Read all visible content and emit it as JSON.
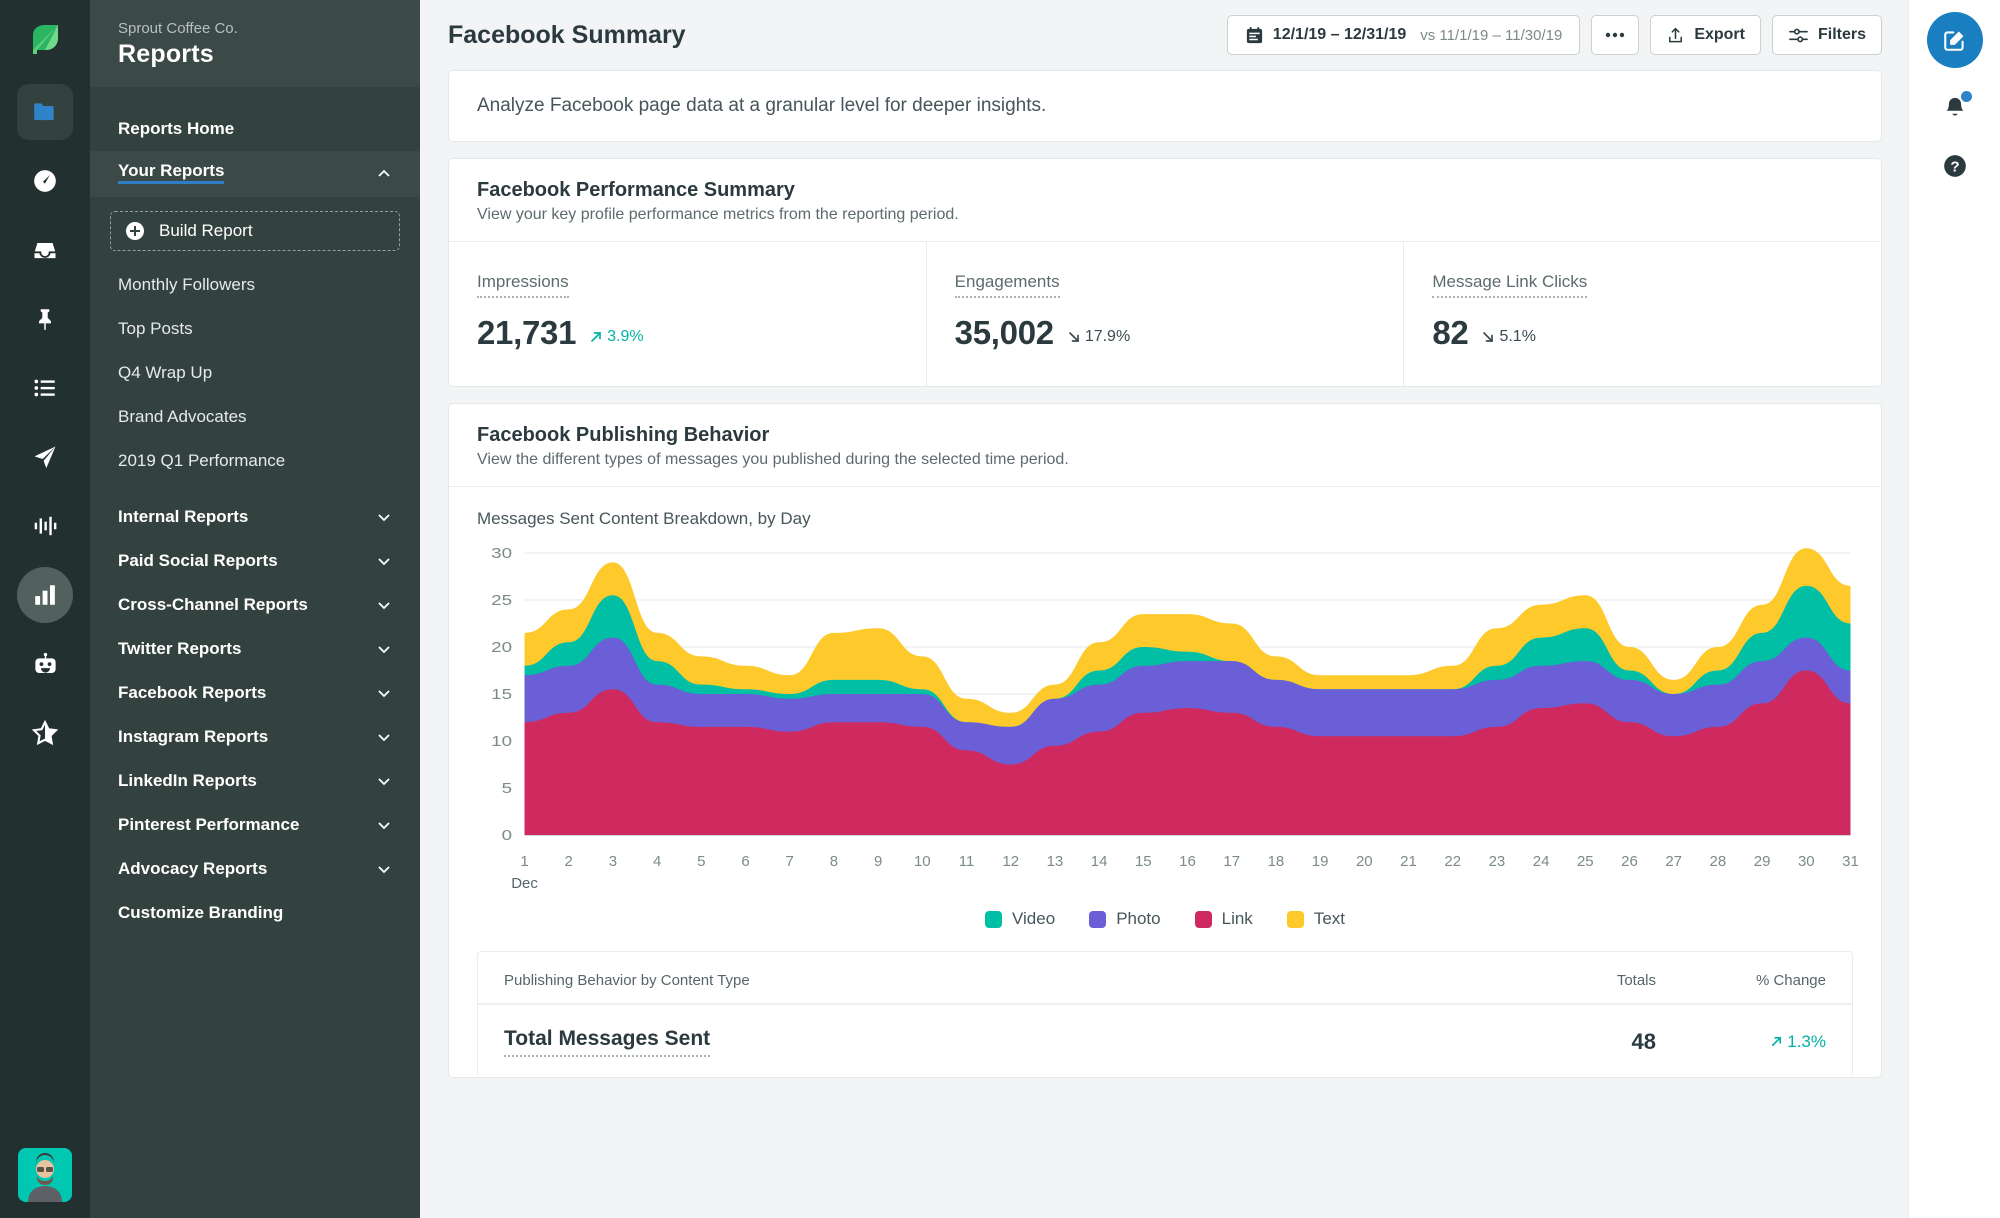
{
  "rail": {
    "logo_icon": "sprout-leaf-logo",
    "items": [
      {
        "icon": "folder-icon",
        "name": "rail-item-publishing",
        "state": "boxed"
      },
      {
        "icon": "gauge-icon",
        "name": "rail-item-dashboard",
        "state": "plain"
      },
      {
        "icon": "inbox-icon",
        "name": "rail-item-inbox",
        "state": "plain"
      },
      {
        "icon": "pin-icon",
        "name": "rail-item-pinned",
        "state": "plain"
      },
      {
        "icon": "list-icon",
        "name": "rail-item-tasks",
        "state": "plain"
      },
      {
        "icon": "send-icon",
        "name": "rail-item-publishing-send",
        "state": "plain"
      },
      {
        "icon": "audio-bars-icon",
        "name": "rail-item-listening",
        "state": "plain"
      },
      {
        "icon": "bar-chart-icon",
        "name": "rail-item-reports",
        "state": "active"
      },
      {
        "icon": "bot-icon",
        "name": "rail-item-bots",
        "state": "plain"
      },
      {
        "icon": "star-icon",
        "name": "rail-item-reviews",
        "state": "plain"
      }
    ],
    "avatar_name": "user-avatar"
  },
  "sidebar": {
    "org": "Sprout Coffee Co.",
    "title": "Reports",
    "home_label": "Reports Home",
    "your_reports_label": "Your Reports",
    "build_report_label": "Build Report",
    "reports": [
      "Monthly Followers",
      "Top Posts",
      "Q4 Wrap Up",
      "Brand Advocates",
      "2019 Q1 Performance"
    ],
    "groups": [
      {
        "label": "Internal Reports",
        "expandable": true
      },
      {
        "label": "Paid Social Reports",
        "expandable": true
      },
      {
        "label": "Cross-Channel Reports",
        "expandable": true
      },
      {
        "label": "Twitter Reports",
        "expandable": true
      },
      {
        "label": "Facebook Reports",
        "expandable": true
      },
      {
        "label": "Instagram Reports",
        "expandable": true
      },
      {
        "label": "LinkedIn Reports",
        "expandable": true
      },
      {
        "label": "Pinterest Performance",
        "expandable": true
      },
      {
        "label": "Advocacy Reports",
        "expandable": true
      },
      {
        "label": "Customize Branding",
        "expandable": false
      }
    ]
  },
  "topbar": {
    "title": "Facebook Summary",
    "date_range": "12/1/19 – 12/31/19",
    "compare_range": "vs 11/1/19 – 11/30/19",
    "more_label": "•••",
    "export_label": "Export",
    "filters_label": "Filters"
  },
  "intro": "Analyze Facebook page data at a granular level for deeper insights.",
  "performance": {
    "title": "Facebook Performance Summary",
    "subtitle": "View your key profile performance metrics from the reporting period.",
    "metrics": [
      {
        "label": "Impressions",
        "value": "21,731",
        "change": "3.9%",
        "direction": "up"
      },
      {
        "label": "Engagements",
        "value": "35,002",
        "change": "17.9%",
        "direction": "down"
      },
      {
        "label": "Message Link Clicks",
        "value": "82",
        "change": "5.1%",
        "direction": "down"
      }
    ]
  },
  "publishing": {
    "title": "Facebook Publishing Behavior",
    "subtitle": "View the different types of messages you published during the selected time period.",
    "chart_caption": "Messages Sent Content Breakdown, by Day",
    "table": {
      "col_name": "Publishing Behavior by Content Type",
      "col_totals": "Totals",
      "col_change": "% Change",
      "rows": [
        {
          "name": "Total Messages Sent",
          "total": "48",
          "change": "1.3%",
          "direction": "up"
        }
      ]
    }
  },
  "colors": {
    "video": "#00bfa5",
    "photo": "#6a5fd6",
    "link": "#cf २a5f",
    "text": "#fdc92b",
    "accent_blue": "#1a7fc1",
    "teal_up": "#00b3a4",
    "sidebar": "#33413f",
    "rail": "#22312f"
  },
  "right_rail": {
    "compose_icon": "compose-pencil-icon",
    "notifications_icon": "bell-icon",
    "help_icon": "question-circle-icon"
  },
  "chart_data": {
    "type": "area",
    "stacked": true,
    "title": "Messages Sent Content Breakdown, by Day",
    "xlabel": "Dec",
    "ylabel": "",
    "ylim": [
      0,
      30
    ],
    "yticks": [
      0,
      5,
      10,
      15,
      20,
      25,
      30
    ],
    "grid": true,
    "legend_position": "bottom",
    "categories": [
      "1",
      "2",
      "3",
      "4",
      "5",
      "6",
      "7",
      "8",
      "9",
      "10",
      "11",
      "12",
      "13",
      "14",
      "15",
      "16",
      "17",
      "18",
      "19",
      "20",
      "21",
      "22",
      "23",
      "24",
      "25",
      "26",
      "27",
      "28",
      "29",
      "30",
      "31"
    ],
    "series": [
      {
        "name": "Link",
        "color": "#cf2a5f",
        "values": [
          12,
          13,
          15.5,
          12,
          11.5,
          11.5,
          11,
          12,
          12,
          11.5,
          9,
          7.5,
          9.5,
          11,
          13,
          13.5,
          13,
          11.5,
          10.5,
          10.5,
          10.5,
          10.5,
          11.5,
          13.5,
          14,
          12,
          10.5,
          11.5,
          14,
          17.5,
          14
        ]
      },
      {
        "name": "Photo",
        "color": "#6a5fd6",
        "values": [
          5,
          5,
          5.5,
          4,
          3.5,
          3.5,
          3.5,
          3,
          3,
          3.5,
          3,
          4,
          5,
          5,
          5,
          5,
          5.5,
          5,
          5,
          5,
          5,
          5,
          5,
          4.5,
          4.5,
          4.5,
          4.5,
          4.5,
          4.5,
          3.5,
          3.5
        ]
      },
      {
        "name": "Video",
        "color": "#00bfa5",
        "values": [
          1,
          2.5,
          4.5,
          2.5,
          1,
          0.5,
          0.5,
          1.5,
          1.5,
          0.5,
          0,
          0,
          0,
          1.5,
          2,
          1,
          0,
          0,
          0,
          0,
          0,
          0,
          1.5,
          3,
          3.5,
          1,
          0,
          1.5,
          3,
          5.5,
          5
        ]
      },
      {
        "name": "Text",
        "color": "#fdc92b",
        "values": [
          3.5,
          3.5,
          3.5,
          3,
          3,
          2.5,
          2,
          5,
          5.5,
          3.5,
          2.5,
          1.5,
          1.5,
          3,
          3.5,
          4,
          4,
          2.5,
          1.5,
          1.5,
          1.5,
          2.5,
          4,
          3.5,
          3.5,
          2.5,
          1.5,
          2.5,
          3,
          4,
          4
        ]
      }
    ],
    "legend": [
      {
        "label": "Video",
        "color": "#00bfa5"
      },
      {
        "label": "Photo",
        "color": "#6a5fd6"
      },
      {
        "label": "Link",
        "color": "#cf2a5f"
      },
      {
        "label": "Text",
        "color": "#fdc92b"
      }
    ]
  }
}
